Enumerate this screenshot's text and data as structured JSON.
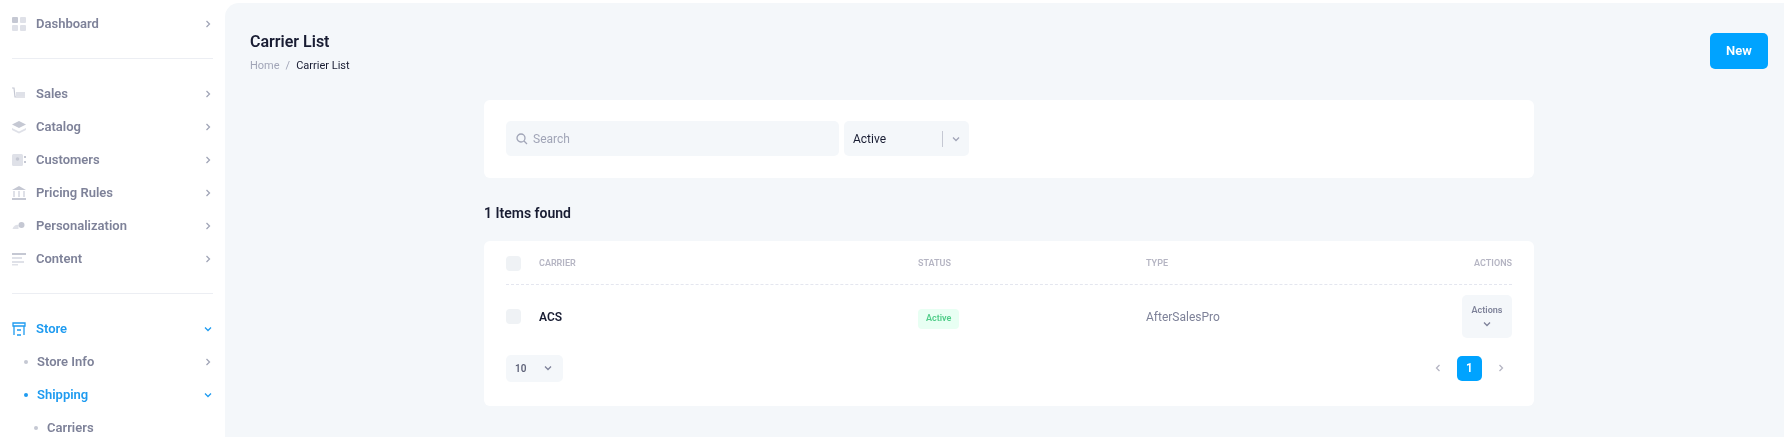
{
  "sidebar": {
    "sections": [
      [
        {
          "kind": "dashboard",
          "label": "Dashboard",
          "expanded": false,
          "active": false
        }
      ],
      [
        {
          "kind": "sales",
          "label": "Sales",
          "expanded": false,
          "active": false
        },
        {
          "kind": "catalog",
          "label": "Catalog",
          "expanded": false,
          "active": false
        },
        {
          "kind": "customers",
          "label": "Customers",
          "expanded": false,
          "active": false
        },
        {
          "kind": "pricing",
          "label": "Pricing Rules",
          "expanded": false,
          "active": false
        },
        {
          "kind": "personalization",
          "label": "Personalization",
          "expanded": false,
          "active": false
        },
        {
          "kind": "content",
          "label": "Content",
          "expanded": false,
          "active": false
        }
      ],
      [
        {
          "kind": "store",
          "label": "Store",
          "expanded": true,
          "active": true,
          "children": [
            {
              "label": "Store Info",
              "expanded": false,
              "active": false,
              "has_children": true
            },
            {
              "label": "Shipping",
              "expanded": true,
              "active": true,
              "has_children": true,
              "children": [
                {
                  "label": "Carriers",
                  "active": false,
                  "has_children": false
                }
              ]
            }
          ]
        }
      ]
    ]
  },
  "page": {
    "title": "Carrier List",
    "breadcrumb": [
      "Home",
      "Carrier List"
    ],
    "breadcrumb_separator": "/",
    "new_button": "New"
  },
  "filters": {
    "search": {
      "placeholder": "Search"
    },
    "status_select": {
      "value": "Active"
    }
  },
  "result_count": "1 Items found",
  "table": {
    "columns": [
      "CARRIER",
      "STATUS",
      "TYPE",
      "ACTIONS"
    ],
    "rows": [
      {
        "checked": false,
        "carrier": "ACS",
        "status": "Active",
        "type": "AfterSalesPro",
        "actions": "Actions"
      }
    ],
    "header_checked": false,
    "page_size": "10",
    "pages": [
      {
        "label": "1",
        "selected": true
      }
    ]
  }
}
